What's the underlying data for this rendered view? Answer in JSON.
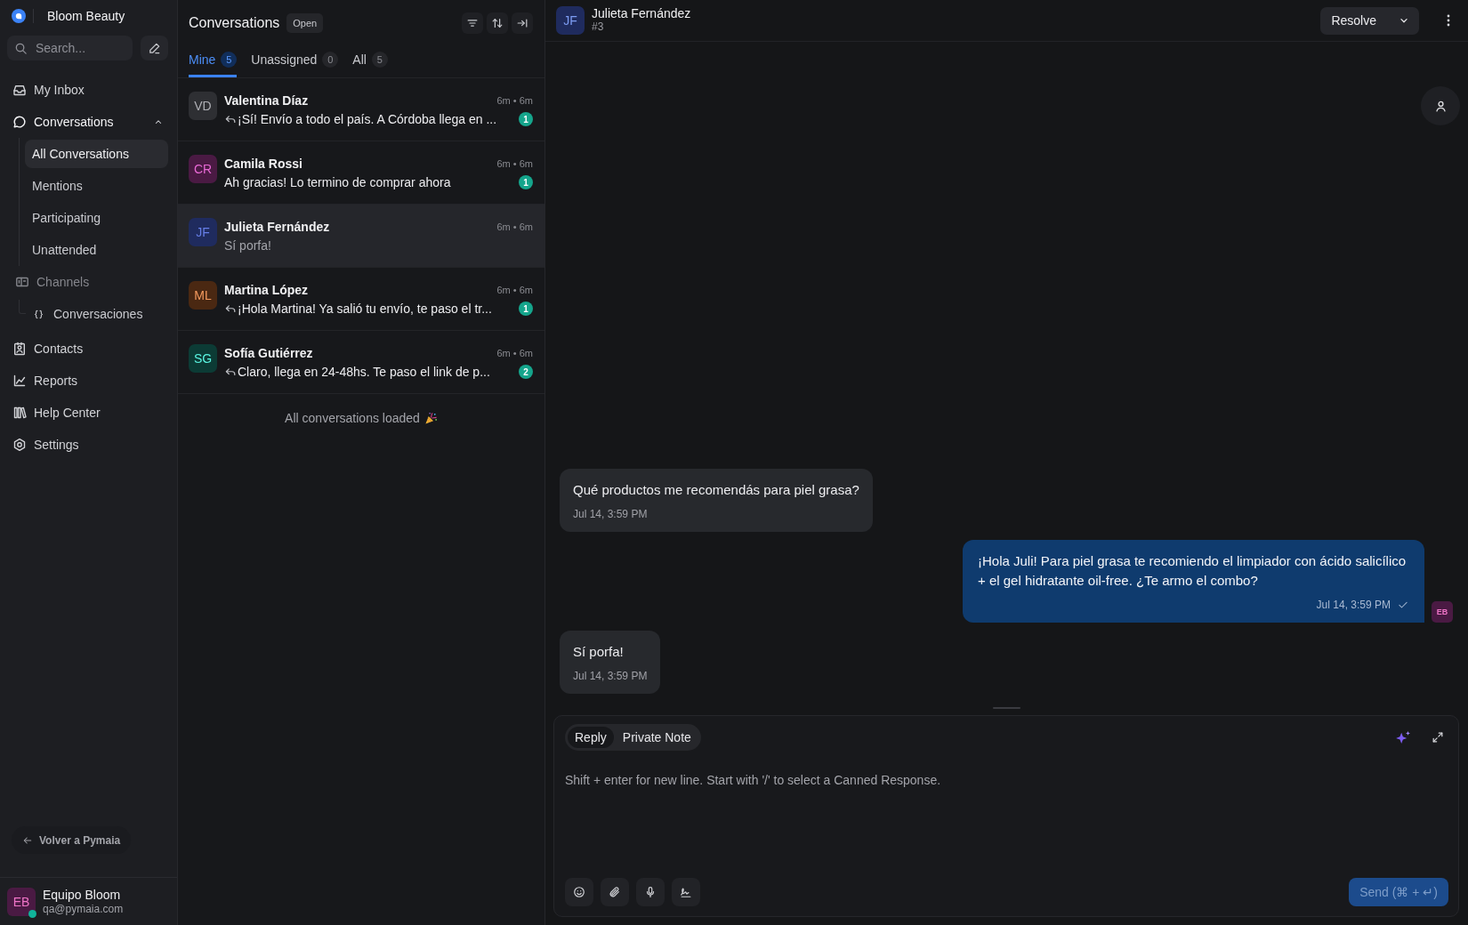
{
  "sidebar": {
    "brand": "Bloom Beauty",
    "search": {
      "placeholder": "Search..."
    },
    "nav": [
      {
        "kind": "link",
        "label": "My Inbox",
        "selected": false
      },
      {
        "kind": "group",
        "label": "Conversations",
        "expanded": true,
        "children": [
          {
            "label": "All Conversations",
            "selected": true
          },
          {
            "label": "Mentions",
            "selected": false
          },
          {
            "label": "Participating",
            "selected": false
          },
          {
            "label": "Unattended",
            "selected": false
          }
        ]
      },
      {
        "kind": "section",
        "label": "Channels",
        "children": [
          {
            "label": "Conversaciones",
            "selected": false
          }
        ]
      },
      {
        "kind": "link",
        "label": "Contacts",
        "selected": false
      },
      {
        "kind": "link",
        "label": "Reports",
        "selected": false
      },
      {
        "kind": "link",
        "label": "Help Center",
        "selected": false
      },
      {
        "kind": "link",
        "label": "Settings",
        "selected": false
      }
    ],
    "back_link": "Volver a Pymaia",
    "user": {
      "initials": "EB",
      "name": "Equipo Bloom",
      "email": "qa@pymaia.com",
      "online": true
    }
  },
  "conversation_list": {
    "title": "Conversations",
    "status_filter": "Open",
    "tabs": [
      {
        "label": "Mine",
        "count": "5",
        "selected": true
      },
      {
        "label": "Unassigned",
        "count": "0",
        "selected": false
      },
      {
        "label": "All",
        "count": "5",
        "selected": false
      }
    ],
    "conversations": [
      {
        "initials": "VD",
        "color": "#2e2f33",
        "name": "Valentina Díaz",
        "time": "6m • 6m",
        "replied": true,
        "preview": "¡Sí! Envío a todo el país. A Córdoba llega en ...",
        "unread": "1",
        "selected": false
      },
      {
        "initials": "CR",
        "color": "#4a1a43",
        "name": "Camila Rossi",
        "time": "6m • 6m",
        "replied": false,
        "preview": "Ah gracias! Lo termino de comprar ahora",
        "unread": "1",
        "selected": false
      },
      {
        "initials": "JF",
        "color": "#1f2b5e",
        "name": "Julieta Fernández",
        "time": "6m • 6m",
        "replied": false,
        "preview": "Sí porfa!",
        "selected": true
      },
      {
        "initials": "ML",
        "color": "#4a2812",
        "name": "Martina López",
        "time": "6m • 6m",
        "replied": true,
        "preview": "¡Hola Martina! Ya salió tu envío, te paso el tr...",
        "unread": "1",
        "selected": false
      },
      {
        "initials": "SG",
        "color": "#0c3b35",
        "name": "Sofía Gutiérrez",
        "time": "6m • 6m",
        "replied": true,
        "preview": "Claro, llega en 24-48hs. Te paso el link de p...",
        "unread": "2",
        "selected": false
      }
    ],
    "end_message": "All conversations loaded"
  },
  "chat": {
    "contact": {
      "initials": "JF",
      "name": "Julieta Fernández",
      "number": "#3"
    },
    "resolve_button": "Resolve",
    "messages": [
      {
        "kind": "incoming",
        "text": "Qué productos me recomendás para piel grasa?",
        "time": "Jul 14, 3:59 PM"
      },
      {
        "kind": "outgoing",
        "text": "¡Hola Juli! Para piel grasa te recomiendo el limpiador con ácido salicílico + el gel hidratante oil-free. ¿Te armo el combo?",
        "time": "Jul 14, 3:59 PM",
        "sent": true,
        "sender_initials": "EB"
      },
      {
        "kind": "incoming",
        "text": "Sí porfa!",
        "time": "Jul 14, 3:59 PM"
      }
    ],
    "composer": {
      "modes": [
        {
          "label": "Reply",
          "selected": true
        },
        {
          "label": "Private Note",
          "selected": false
        }
      ],
      "placeholder": "Shift + enter for new line. Start with '/' to select a Canned Response.",
      "send_button": "Send (⌘ + ↵)",
      "send_disabled": true
    }
  }
}
